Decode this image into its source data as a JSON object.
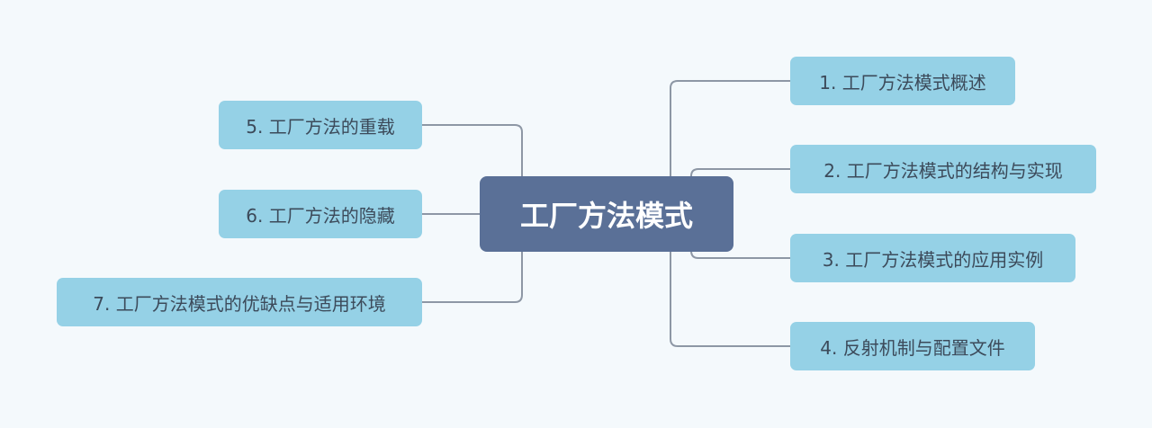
{
  "diagram": {
    "type": "mind-map",
    "root": {
      "label": "工厂方法模式"
    },
    "branches": [
      {
        "id": "b1",
        "label": "1. 工厂方法模式概述",
        "side": "right"
      },
      {
        "id": "b2",
        "label": "2. 工厂方法模式的结构与实现",
        "side": "right"
      },
      {
        "id": "b3",
        "label": "3. 工厂方法模式的应用实例",
        "side": "right"
      },
      {
        "id": "b4",
        "label": "4. 反射机制与配置文件",
        "side": "right"
      },
      {
        "id": "b5",
        "label": "5. 工厂方法的重载",
        "side": "left"
      },
      {
        "id": "b6",
        "label": "6. 工厂方法的隐藏",
        "side": "left"
      },
      {
        "id": "b7",
        "label": "7. 工厂方法模式的优缺点与适用环境",
        "side": "left"
      }
    ]
  },
  "colors": {
    "background": "#f4f9fc",
    "root_fill": "#5a7097",
    "root_text": "#ffffff",
    "branch_fill": "#95d1e6",
    "branch_text": "#3c4a5a",
    "connector": "#8d97a5"
  }
}
